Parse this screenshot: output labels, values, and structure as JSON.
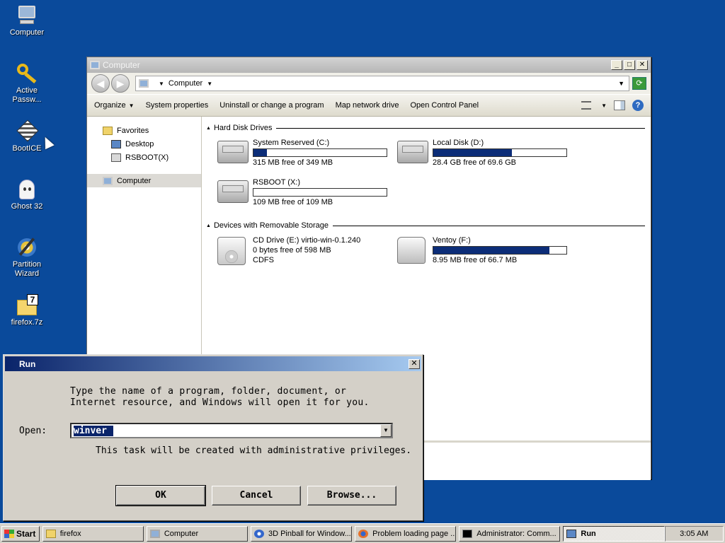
{
  "desktop": {
    "icons": [
      {
        "label": "Computer",
        "icon": "computer-icon"
      },
      {
        "label": "Active Passw...",
        "icon": "key-icon"
      },
      {
        "label": "BootICE",
        "icon": "bootice-icon"
      },
      {
        "label": "Ghost 32",
        "icon": "ghost-icon"
      },
      {
        "label": "Partition Wizard",
        "icon": "partition-wizard-icon"
      },
      {
        "label": "firefox.7z",
        "icon": "archive-icon"
      }
    ]
  },
  "explorer": {
    "title": "Computer",
    "address": "Computer",
    "commands": [
      "Organize",
      "System properties",
      "Uninstall or change a program",
      "Map network drive",
      "Open Control Panel"
    ],
    "nav": {
      "favorites": "Favorites",
      "desktop": "Desktop",
      "rsboot": "RSBOOT(X)",
      "computer": "Computer"
    },
    "groups": {
      "hdd": "Hard Disk Drives",
      "removable": "Devices with Removable Storage"
    },
    "drives": [
      {
        "name": "System Reserved (C:)",
        "free": "315 MB free of 349 MB",
        "used_fraction": 0.1
      },
      {
        "name": "Local Disk (D:)",
        "free": "28.4 GB free of 69.6 GB",
        "used_fraction": 0.59
      },
      {
        "name": "RSBOOT (X:)",
        "free": "109 MB free of 109 MB",
        "used_fraction": 0.0
      }
    ],
    "removable": [
      {
        "name": "CD Drive (E:) virtio-win-0.1.240",
        "free": "0 bytes free of 598 MB",
        "fs": "CDFS"
      },
      {
        "name": "Ventoy (F:)",
        "free": "8.95 MB free of 66.7 MB",
        "used_fraction": 0.87
      }
    ]
  },
  "run": {
    "title": "Run",
    "line1": "Type the name of a program, folder, document, or",
    "line2": "Internet resource, and Windows will open it for you.",
    "open_label": "Open:",
    "value": "winver",
    "admin_note": "This task will be created with administrative privileges.",
    "ok": "OK",
    "cancel": "Cancel",
    "browse": "Browse..."
  },
  "taskbar": {
    "start": "Start",
    "tasks": [
      {
        "label": "firefox",
        "icon": "folder-icon"
      },
      {
        "label": "Computer",
        "icon": "computer-icon"
      },
      {
        "label": "3D Pinball for Window...",
        "icon": "pinball-icon"
      },
      {
        "label": "Problem loading page ...",
        "icon": "firefox-icon"
      },
      {
        "label": "Administrator: Comm...",
        "icon": "cmd-icon"
      },
      {
        "label": "Run",
        "icon": "run-icon"
      }
    ],
    "clock": "3:05 AM"
  }
}
